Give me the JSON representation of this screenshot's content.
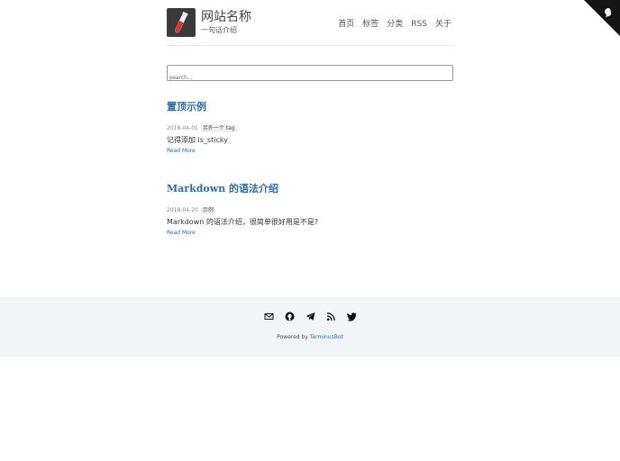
{
  "site": {
    "title": "网站名称",
    "description": "一句话介绍"
  },
  "nav": {
    "items": [
      {
        "label": "首页"
      },
      {
        "label": "标签"
      },
      {
        "label": "分类"
      },
      {
        "label": "RSS"
      },
      {
        "label": "关于"
      }
    ]
  },
  "search": {
    "placeholder": "search..."
  },
  "posts": [
    {
      "title": "置顶示例",
      "date": "2018-04-01",
      "tag": "另外一个 tag",
      "excerpt": "记得添加 is_sticky",
      "read_more": "Read More"
    },
    {
      "title": "Markdown 的语法介绍",
      "date": "2018-04-20",
      "tag": "示例",
      "excerpt": "Markdown 的语法介绍，很简单很好用是不是?",
      "read_more": "Read More"
    }
  ],
  "footer": {
    "social_icons": [
      "mail-icon",
      "github-icon",
      "telegram-icon",
      "rss-icon",
      "twitter-icon"
    ],
    "powered_prefix": "Powered by",
    "powered_link": "TerminusBot"
  },
  "colors": {
    "link": "#2a6cb0",
    "footer_bg": "#f3f4f5",
    "logo_bg": "#3a3a3a"
  }
}
